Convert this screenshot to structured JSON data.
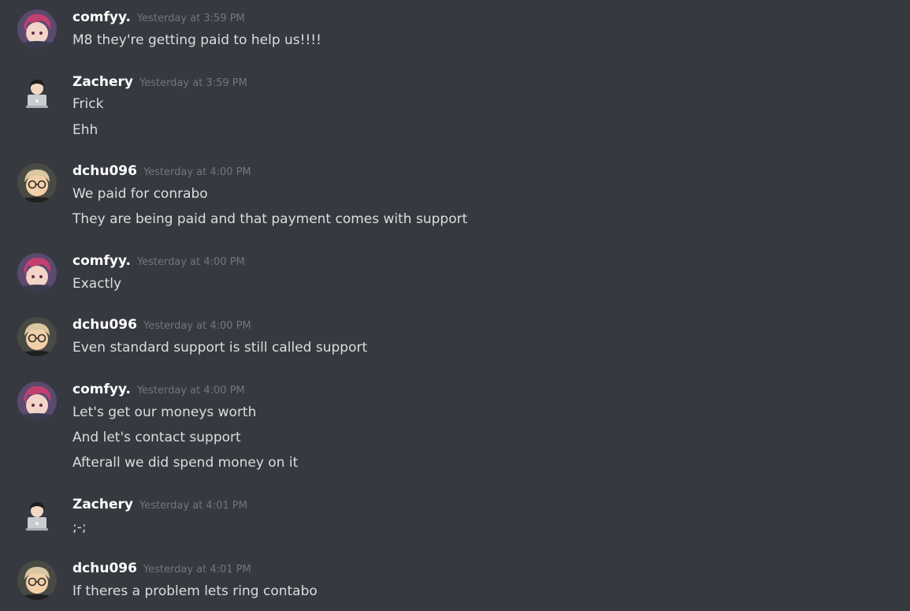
{
  "messages": [
    {
      "username": "comfyy.",
      "avatar": "anime-girl-avatar-icon",
      "timestamp": "Yesterday at 3:59 PM",
      "lines": [
        "M8 they're getting paid to help us!!!!"
      ]
    },
    {
      "username": "Zachery",
      "avatar": "laptop-person-avatar-icon",
      "timestamp": "Yesterday at 3:59 PM",
      "lines": [
        "Frick",
        "Ehh"
      ]
    },
    {
      "username": "dchu096",
      "avatar": "boy-glasses-avatar-icon",
      "timestamp": "Yesterday at 4:00 PM",
      "lines": [
        "We paid for conrabo",
        "They are being paid and that payment comes with support"
      ]
    },
    {
      "username": "comfyy.",
      "avatar": "anime-girl-avatar-icon",
      "timestamp": "Yesterday at 4:00 PM",
      "lines": [
        "Exactly"
      ]
    },
    {
      "username": "dchu096",
      "avatar": "boy-glasses-avatar-icon",
      "timestamp": "Yesterday at 4:00 PM",
      "lines": [
        "Even standard support is still called support"
      ]
    },
    {
      "username": "comfyy.",
      "avatar": "anime-girl-avatar-icon",
      "timestamp": "Yesterday at 4:00 PM",
      "lines": [
        "Let's get our moneys worth",
        "And let's contact support",
        "Afterall we did spend money on it"
      ]
    },
    {
      "username": "Zachery",
      "avatar": "laptop-person-avatar-icon",
      "timestamp": "Yesterday at 4:01 PM",
      "lines": [
        ";-;"
      ]
    },
    {
      "username": "dchu096",
      "avatar": "boy-glasses-avatar-icon",
      "timestamp": "Yesterday at 4:01 PM",
      "lines": [
        "If theres a problem lets ring contabo"
      ]
    }
  ],
  "colors": {
    "background": "#36393f",
    "username": "#ffffff",
    "timestamp": "#72767d",
    "message_text": "#dcddde"
  }
}
